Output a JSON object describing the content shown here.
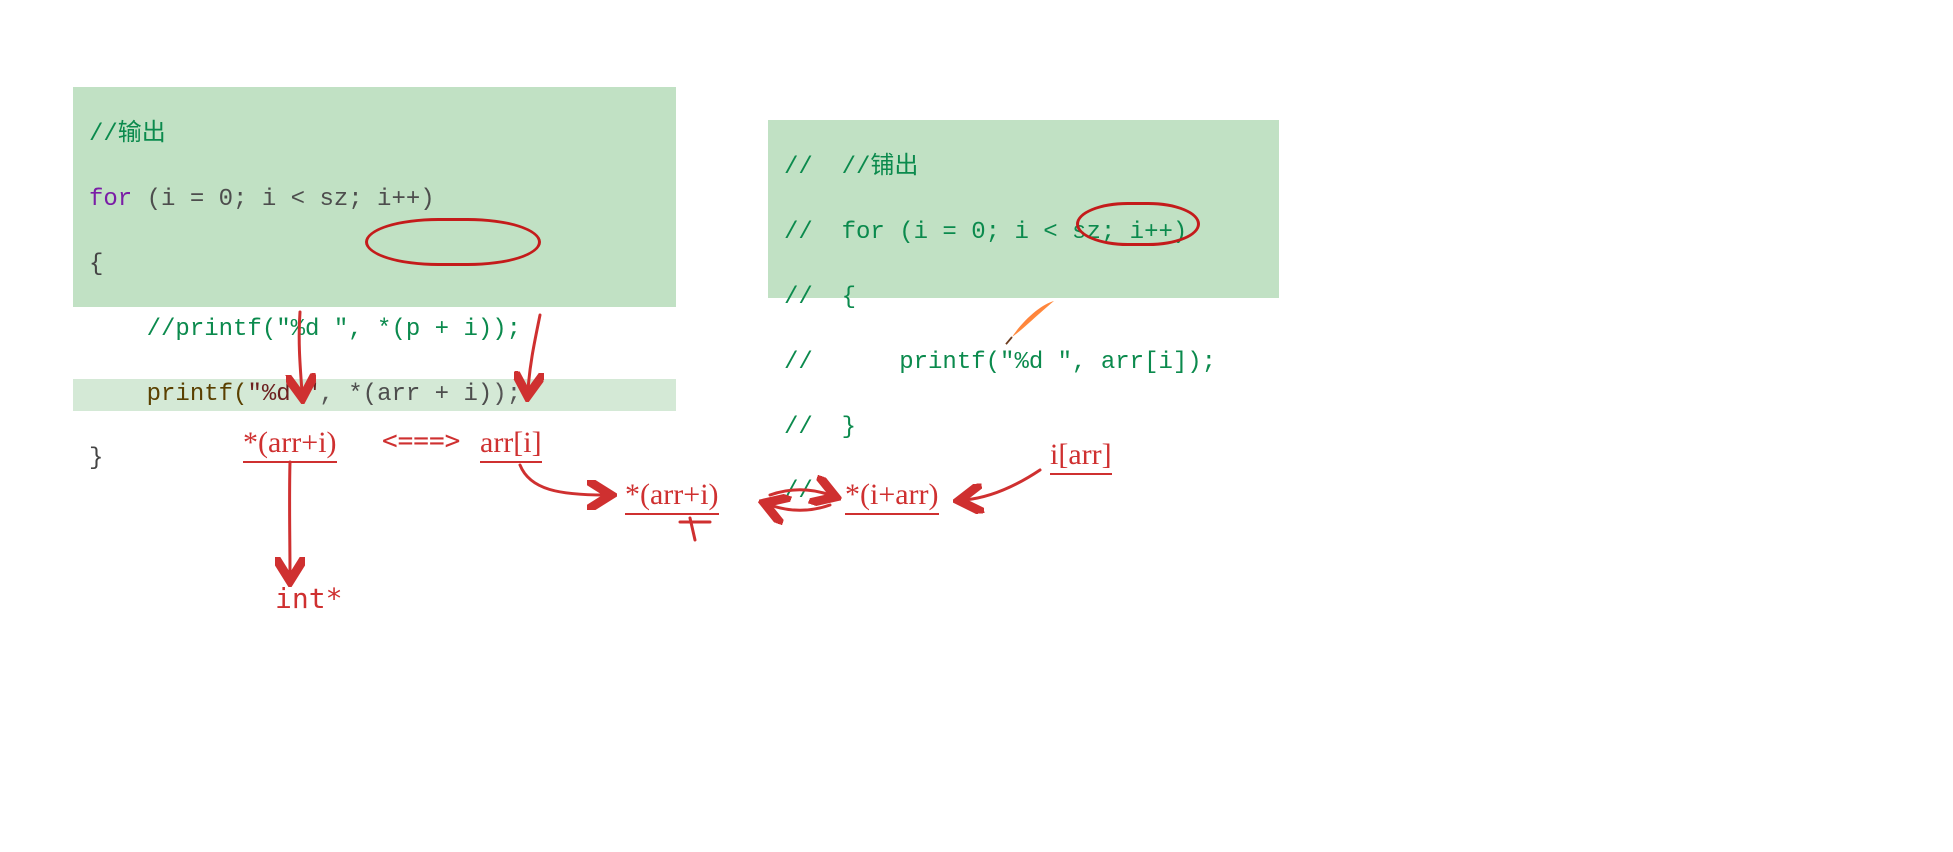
{
  "left_code": {
    "l1_comment": "//输出",
    "l2_for": "for",
    "l2_rest": " (i = 0; i < sz; i++)",
    "l3": "{",
    "l4_comment": "    //printf(\"%d \", *(p + i));",
    "l5_pre": "    printf(",
    "l5_str": "\"%d \"",
    "l5_comma": ", ",
    "l5_expr": "*(arr + i)",
    "l5_end": ");",
    "l6": "}"
  },
  "right_code": {
    "l0a": "//",
    "l0b": "  //铺出",
    "l1a": "//",
    "l1b": "  for (i = 0; i < sz; i++)",
    "l2a": "//",
    "l2b": "  {",
    "l3a": "//",
    "l3b": "      printf(\"%d \", arr[i]);",
    "l4a": "//",
    "l4b": "  }",
    "l5a": "//"
  },
  "annot": {
    "expr1": "*(arr+i)",
    "equiv": "<===>",
    "expr2": "arr[i]",
    "expr3": "*(arr+i)",
    "bidir": "↔",
    "expr4": "*(i+arr)",
    "expr5": "i[arr]",
    "type": "int*"
  }
}
